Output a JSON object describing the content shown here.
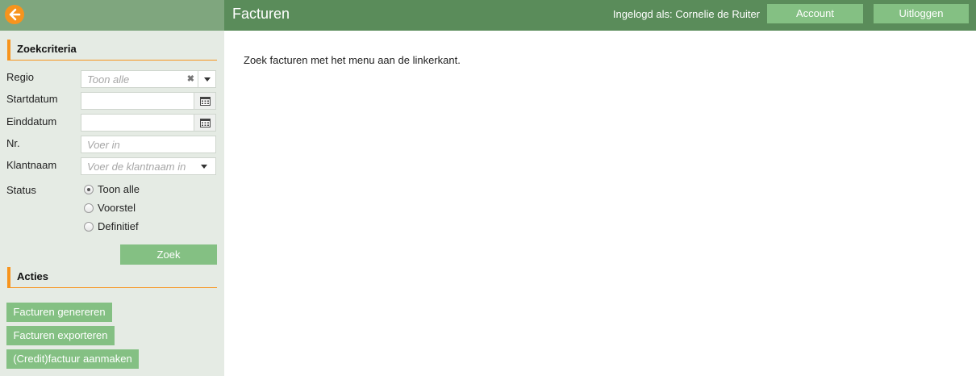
{
  "header": {
    "title": "Facturen",
    "logged_in": "Ingelogd als: Cornelie de Ruiter",
    "account_label": "Account",
    "logout_label": "Uitloggen"
  },
  "sidebar": {
    "search_heading": "Zoekcriteria",
    "fields": {
      "regio_label": "Regio",
      "regio_placeholder": "Toon alle",
      "startdatum_label": "Startdatum",
      "einddatum_label": "Einddatum",
      "nr_label": "Nr.",
      "nr_placeholder": "Voer in",
      "klantnaam_label": "Klantnaam",
      "klantnaam_placeholder": "Voer de klantnaam in",
      "status_label": "Status"
    },
    "status_options": [
      "Toon alle",
      "Voorstel",
      "Definitief"
    ],
    "status_selected": "Toon alle",
    "search_button": "Zoek",
    "actions_heading": "Acties",
    "actions": [
      "Facturen genereren",
      "Facturen exporteren",
      "(Credit)factuur aanmaken"
    ]
  },
  "main": {
    "message": "Zoek facturen met het menu aan de linkerkant."
  },
  "icons": {
    "back": "arrow-left-circle-icon",
    "calendar": "calendar-icon",
    "clear": "clear-x-icon",
    "dropdown": "chevron-down-icon"
  },
  "colors": {
    "sidebar_bg": "#e5ebe4",
    "header_bg": "#5a8c5a",
    "sidebar_top_bg": "#7fa67e",
    "button_green": "#84c083",
    "accent_orange": "#f7941d"
  }
}
